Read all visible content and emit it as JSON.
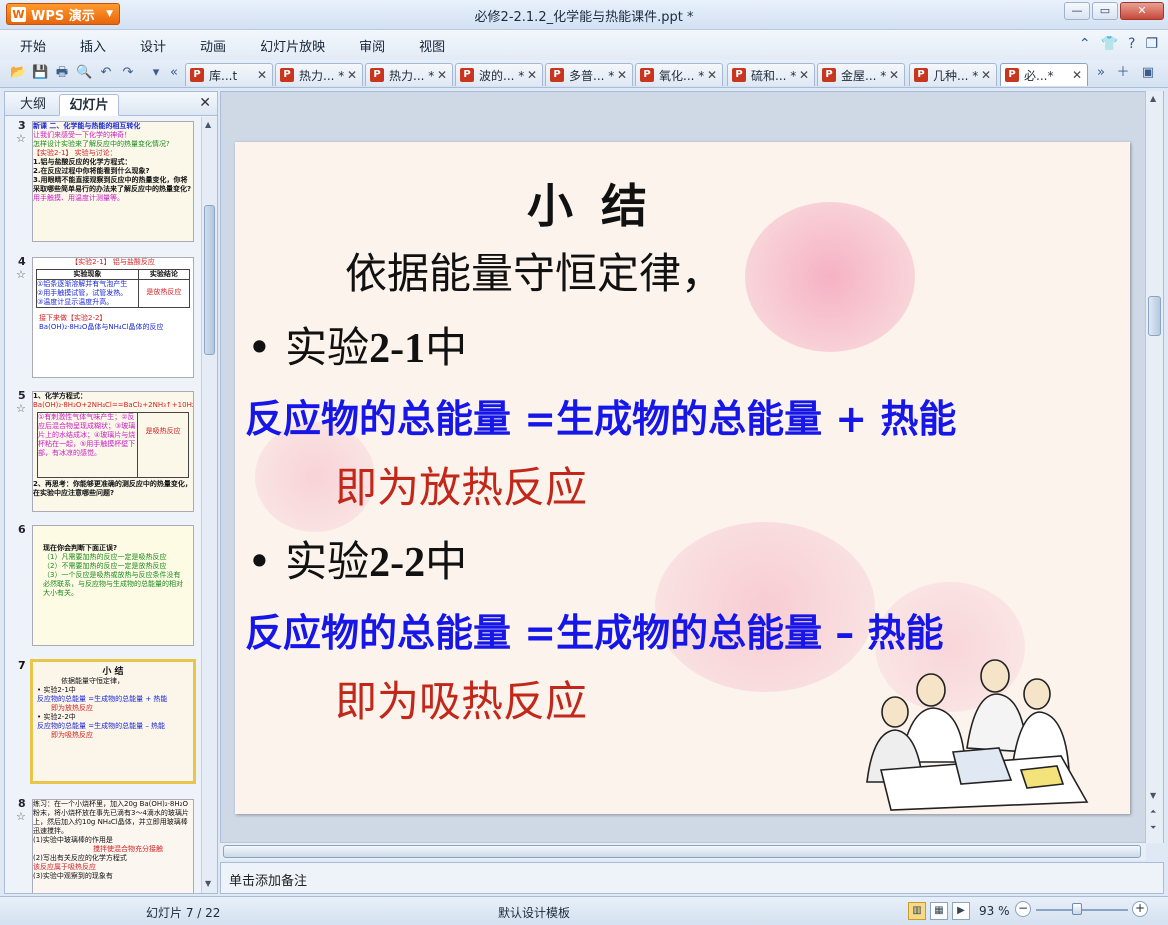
{
  "window": {
    "app_name": "WPS 演示",
    "title": "必修2-2.1.2_化学能与热能课件.ppt *",
    "controls": [
      "minimize-icon",
      "maximize-icon",
      "close-icon"
    ]
  },
  "menu": [
    "开始",
    "插入",
    "设计",
    "动画",
    "幻灯片放映",
    "审阅",
    "视图"
  ],
  "tabs": [
    {
      "label": "库...t",
      "active": false
    },
    {
      "label": "热力... *",
      "active": false
    },
    {
      "label": "热力... *",
      "active": false
    },
    {
      "label": "波的... *",
      "active": false
    },
    {
      "label": "多普... *",
      "active": false
    },
    {
      "label": "氧化... *",
      "active": false
    },
    {
      "label": "硫和... *",
      "active": false
    },
    {
      "label": "金屋... *",
      "active": false
    },
    {
      "label": "几种... *",
      "active": false
    },
    {
      "label": "必...*",
      "active": true
    }
  ],
  "left_pane": {
    "tab_outline": "大纲",
    "tab_slides": "幻灯片",
    "slides": [
      {
        "num": "3",
        "lines": [
          "新课 二、化学能与热能的相互转化",
          "让我们来感受一下化学的神奇！",
          "怎样设计实验来了解反应中的热量变化情况?",
          "【实验2-1】 实验与讨论：",
          "1.铝与盐酸反应的化学方程式：",
          "2.在反应过程中你将能看到什么现象?",
          "3.用眼睛不能直接观察到反应中的热量变化，你将采取哪些简单易行的办法来了解反应中的热量变化?",
          "用手触摸、用温度计测量等。"
        ]
      },
      {
        "num": "4",
        "lines": [
          "【实验2-1】 铝与盐酸反应",
          "实验现象",
          "实验结论",
          "①铝条逐渐溶解并有气泡产生",
          "②用手触摸试管，试管发热。",
          "③温度计显示温度升高。",
          "是放热反应",
          "接下来做【实验2-2】",
          "Ba(OH)₂·8H₂O晶体与NH₄Cl晶体的反应"
        ]
      },
      {
        "num": "5",
        "lines": [
          "1、化学方程式：",
          "Ba(OH)₂·8H₂O+2NH₄Cl==BaCl₂+2NH₃↑+10H₂O",
          "①有刺激性气体气味产生；②反应后混合物呈现成糊状；③玻璃片上的水结成冰；④玻璃片与烧杯粘在一起，⑤用手触摸杯壁下部，有冰凉的感觉。",
          "是吸热反应",
          "2、再思考：你能够更准确的测反应中的热量变化，在实验中应注意哪些问题?"
        ]
      },
      {
        "num": "6",
        "lines": [
          "现在你会判断下面正误?",
          "（1）凡需要加热的反应一定是吸热反应",
          "（2）不需要加热的反应一定是放热反应",
          "（3）一个反应是吸热或放热与反应条件没有必然联系，与反应物与生成物的总能量的相对大小有关。"
        ]
      },
      {
        "num": "7",
        "lines": [
          "小 结",
          "依据能量守恒定律，",
          "• 实验2-1中",
          "反应物的总能量 =生成物的总能量 + 热能",
          "即为放热反应",
          "• 实验2-2中",
          "反应物的总能量 =生成物的总能量 – 热能",
          "即为吸热反应"
        ]
      },
      {
        "num": "8",
        "lines": [
          "练习：在一个小烧杯里，加入20g Ba(OH)₂·8H₂O粉末，将小烧杯放在事先已滴有3～4滴水的玻璃片上，然后加入约10g NH₄Cl晶体，并立即用玻璃棒迅速搅拌。",
          "(1)实验中玻璃棒的作用是",
          "搅拌使混合物充分接触",
          "(2)写出有关反应的化学方程式",
          "该反应属于吸热反应",
          "(3)实验中观察到的现象有"
        ]
      }
    ]
  },
  "slide": {
    "title": "小 结",
    "line1": "依据能量守恒定律，",
    "bullet1_prefix": "• 实验",
    "bullet1_num": "2-1",
    "bullet1_suffix": "中",
    "eq1": "反应物的总能量 =生成物的总能量 + 热能",
    "result1": "即为放热反应",
    "bullet2_prefix": "•  实验",
    "bullet2_num": "2-2",
    "bullet2_suffix": "中",
    "eq2": "反应物的总能量 =生成物的总能量 – 热能",
    "result2": "即为吸热反应"
  },
  "notes": {
    "placeholder": "单击添加备注"
  },
  "status": {
    "slide_counter": "幻灯片 7 / 22",
    "template": "默认设计模板",
    "zoom": "93 %"
  },
  "colors": {
    "accent_blue": "#1616e8",
    "accent_red": "#c2281a",
    "app_orange": "#e8650a",
    "selected_thumb": "#e9c54c"
  }
}
